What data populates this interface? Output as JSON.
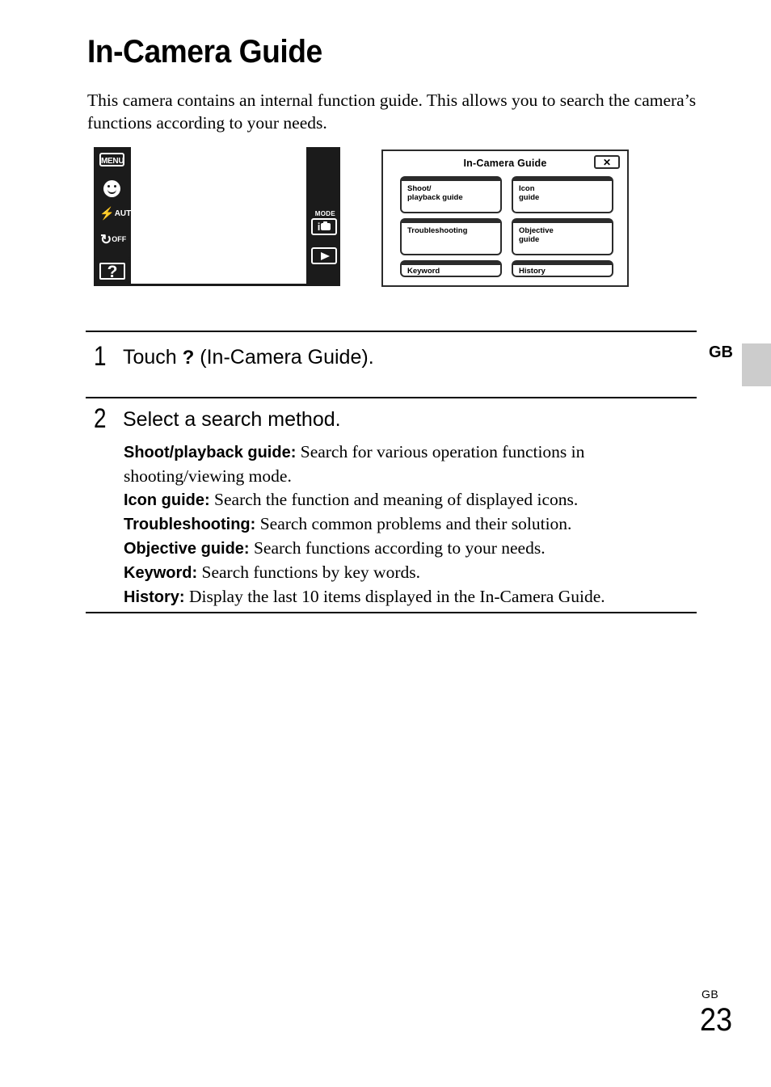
{
  "page": {
    "title": "In-Camera Guide",
    "intro": "This camera contains an internal function guide. This allows you to search the camera’s functions according to your needs."
  },
  "side_tab": {
    "label": "GB"
  },
  "footer": {
    "region": "GB",
    "page_number": "23"
  },
  "figure_lcd": {
    "menu_button": "MENU",
    "smile_icon": "smile-shutter-icon",
    "flash_icon": "flash-icon",
    "flash_label": "AUTO",
    "self_timer_icon": "self-timer-icon",
    "self_timer_label": "OFF",
    "help_button": "?",
    "mode_label": "MODE",
    "mode_icon_text": "i",
    "mode_icon": "intelligent-auto-camera-icon",
    "playback_icon": "playback-triangle-icon"
  },
  "figure_dialog": {
    "title": "In-Camera Guide",
    "close_label": "✕",
    "buttons": [
      {
        "label": "Shoot/\nplayback guide",
        "name": "shoot-playback-guide"
      },
      {
        "label": "Icon\nguide",
        "name": "icon-guide"
      },
      {
        "label": "Troubleshooting",
        "name": "troubleshooting"
      },
      {
        "label": "Objective\nguide",
        "name": "objective-guide"
      },
      {
        "label": "Keyword",
        "name": "keyword"
      },
      {
        "label": "History",
        "name": "history"
      }
    ]
  },
  "steps": [
    {
      "number": "1",
      "heading_prefix": "Touch ",
      "heading_mark": "?",
      "heading_suffix": " (In-Camera Guide)."
    },
    {
      "number": "2",
      "heading": "Select a search method."
    }
  ],
  "definitions": [
    {
      "term": "Shoot/playback guide:",
      "desc": " Search for various operation functions in shooting/viewing mode."
    },
    {
      "term": "Icon guide:",
      "desc": " Search the function and meaning of displayed icons."
    },
    {
      "term": "Troubleshooting:",
      "desc": " Search common problems and their solution."
    },
    {
      "term": "Objective guide:",
      "desc": " Search functions according to your needs."
    },
    {
      "term": "Keyword:",
      "desc": " Search functions by key words."
    },
    {
      "term": "History:",
      "desc": " Display the last 10 items displayed in the In-Camera Guide."
    }
  ]
}
